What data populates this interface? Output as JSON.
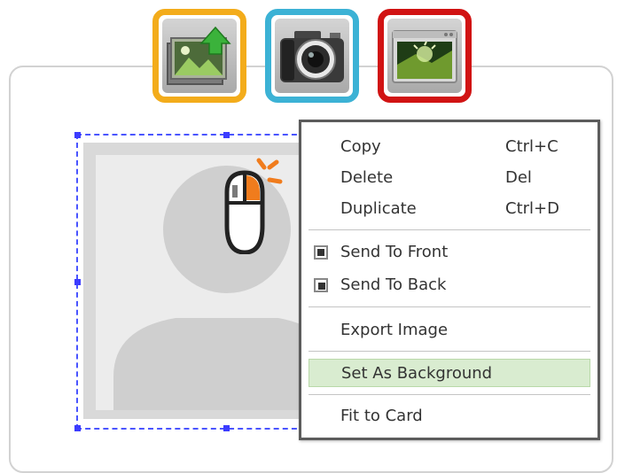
{
  "toolbar": {
    "buttons": [
      {
        "name": "add-images",
        "icon": "image-upload-icon",
        "color": "#f3ac1b"
      },
      {
        "name": "camera",
        "icon": "camera-icon",
        "color": "#3cb2d5"
      },
      {
        "name": "background",
        "icon": "background-window-icon",
        "color": "#d11313"
      }
    ]
  },
  "canvas": {
    "selected_item_icon": "person-placeholder-icon",
    "cursor_icon": "mouse-right-click-icon",
    "selection_color": "#3c3cff"
  },
  "context_menu": {
    "copy": {
      "label": "Copy",
      "shortcut": "Ctrl+C"
    },
    "delete": {
      "label": "Delete",
      "shortcut": "Del"
    },
    "duplicate": {
      "label": "Duplicate",
      "shortcut": "Ctrl+D"
    },
    "send_to_front": {
      "label": "Send To Front",
      "icon": "bring-to-front-icon"
    },
    "send_to_back": {
      "label": "Send To Back",
      "icon": "send-to-back-icon"
    },
    "export_image": {
      "label": "Export Image"
    },
    "set_as_background": {
      "label": "Set As Background",
      "highlighted": true,
      "highlight_color": "#d9ecd0"
    },
    "fit_to_card": {
      "label": "Fit to Card"
    }
  }
}
